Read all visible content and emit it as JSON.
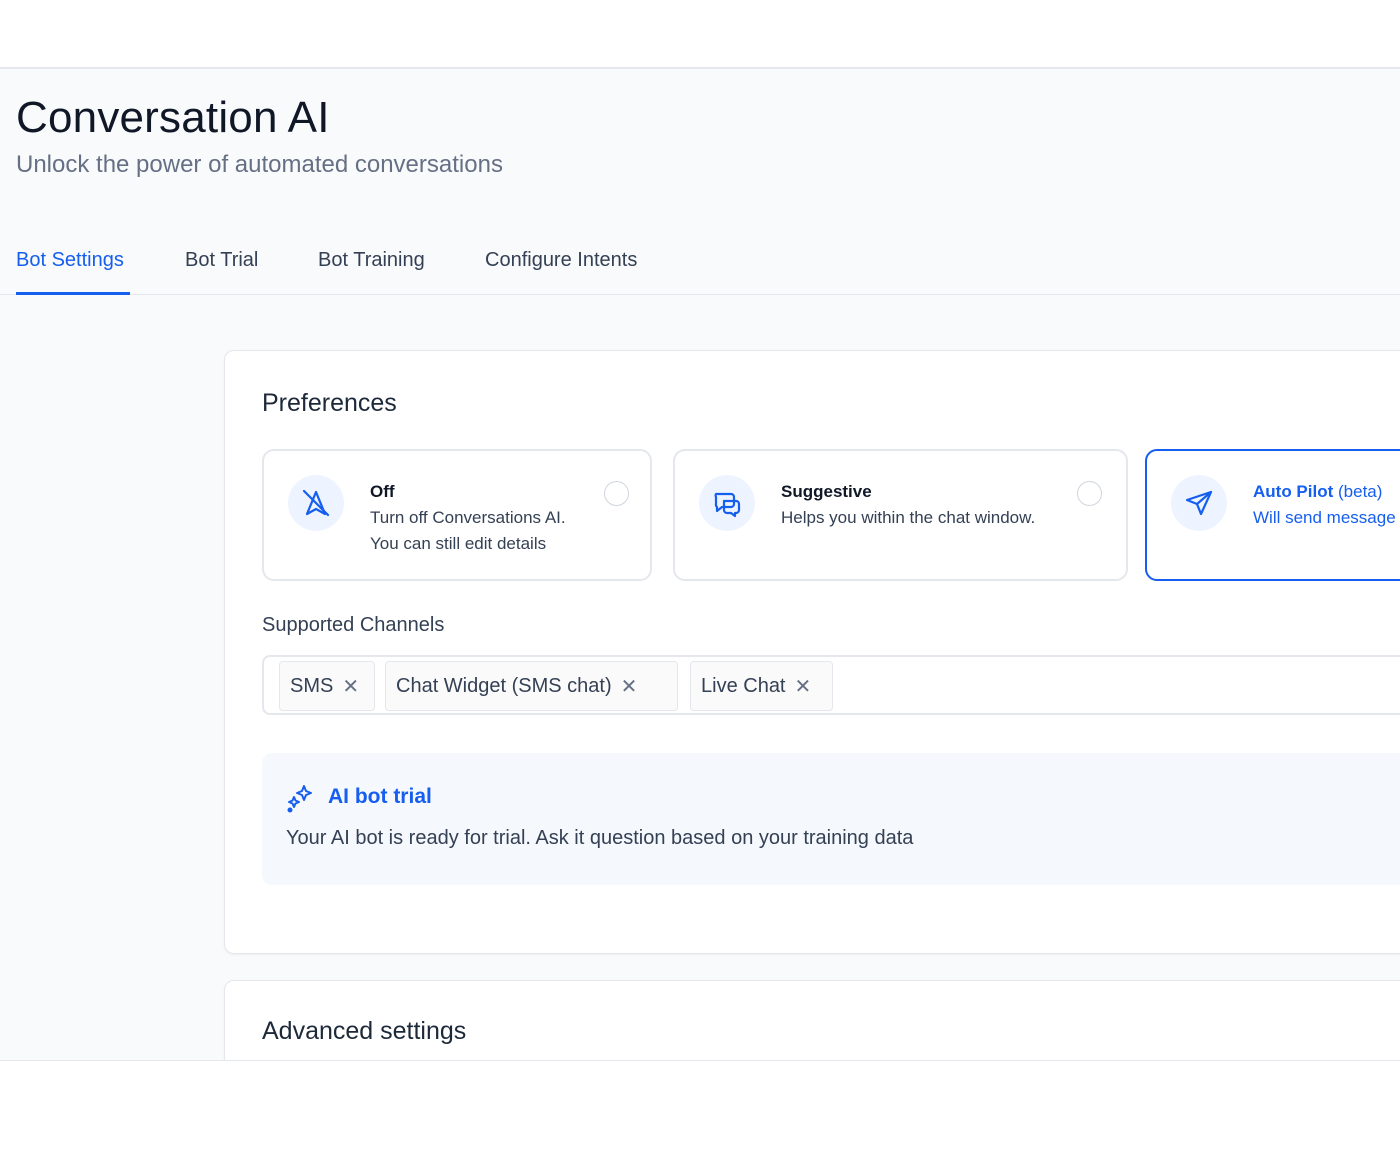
{
  "header": {
    "title": "Conversation AI",
    "subtitle": "Unlock the power of automated conversations"
  },
  "tabs": [
    {
      "label": "Bot Settings",
      "active": true
    },
    {
      "label": "Bot Trial",
      "active": false
    },
    {
      "label": "Bot Training",
      "active": false
    },
    {
      "label": "Configure Intents",
      "active": false
    }
  ],
  "preferences": {
    "title": "Preferences",
    "selected": "Auto Pilot",
    "options": [
      {
        "name": "Off",
        "desc_line1": "Turn off Conversations AI.",
        "desc_line2": "You can still edit details",
        "icon": "robot-off-icon"
      },
      {
        "name": "Suggestive",
        "desc_line1": "Helps you within the chat window.",
        "icon": "chat-bubbles-icon"
      },
      {
        "name": "Auto Pilot",
        "suffix": "(beta)",
        "desc_line1": "Will send message",
        "icon": "send-icon"
      }
    ]
  },
  "channels": {
    "label": "Supported Channels",
    "items": [
      "SMS",
      "Chat Widget (SMS chat)",
      "Live Chat"
    ],
    "remove_glyph": "✕"
  },
  "trial": {
    "title": "AI bot trial",
    "desc": "Your AI bot is ready for trial. Ask it question based on your training data",
    "icon": "sparkles-icon"
  },
  "advanced": {
    "title": "Advanced settings"
  },
  "colors": {
    "accent": "#155eef",
    "background": "#f9fafb",
    "border": "#e4e7ec"
  }
}
